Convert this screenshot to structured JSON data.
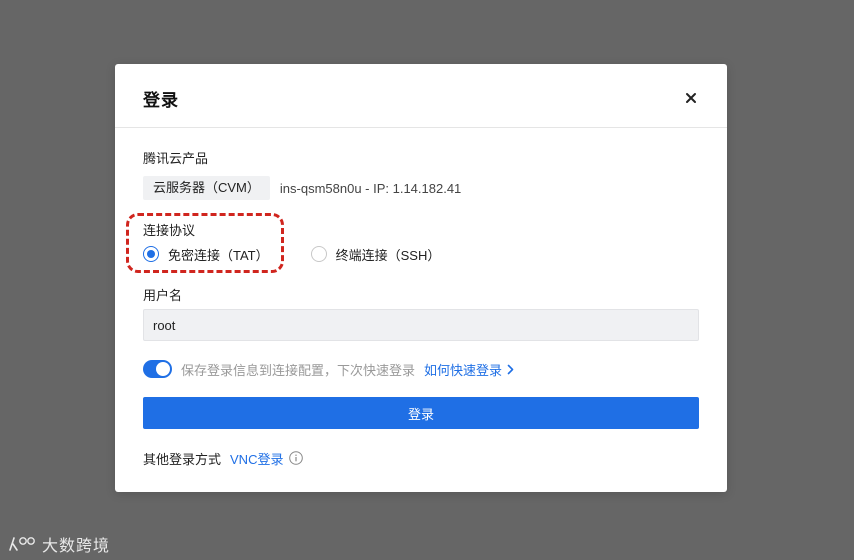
{
  "dialog": {
    "title": "登录",
    "close_label": "×"
  },
  "product": {
    "label": "腾讯云产品",
    "tag": "云服务器（CVM）",
    "instance_info": "ins-qsm58n0u - IP: 1.14.182.41"
  },
  "protocol": {
    "label": "连接协议",
    "options": [
      {
        "label": "免密连接（TAT）",
        "selected": true
      },
      {
        "label": "终端连接（SSH）",
        "selected": false
      }
    ]
  },
  "username": {
    "label": "用户名",
    "value": "root"
  },
  "save_config": {
    "enabled": true,
    "text": "保存登录信息到连接配置，下次快速登录",
    "link_label": "如何快速登录"
  },
  "login_button": {
    "label": "登录"
  },
  "other_login": {
    "label": "其他登录方式",
    "vnc_label": "VNC登录"
  },
  "watermark": {
    "text": "大数跨境"
  },
  "colors": {
    "primary": "#1f6fe5",
    "highlight": "#d0251e",
    "overlay": "#666666"
  }
}
